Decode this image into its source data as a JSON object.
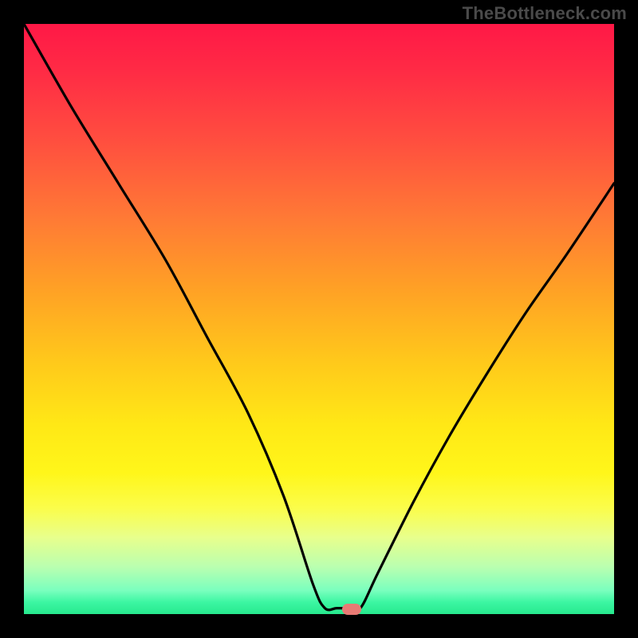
{
  "watermark": "TheBottleneck.com",
  "chart_data": {
    "type": "line",
    "title": "",
    "xlabel": "",
    "ylabel": "",
    "xlim": [
      0,
      100
    ],
    "ylim": [
      0,
      100
    ],
    "grid": false,
    "series": [
      {
        "name": "curve",
        "x": [
          0,
          8,
          16,
          24,
          31,
          38,
          44,
          49,
          51,
          53,
          55,
          57,
          60,
          66,
          72,
          78,
          85,
          92,
          100
        ],
        "y": [
          100,
          86,
          73,
          60,
          47,
          34,
          20,
          5,
          1,
          1,
          1,
          1,
          7,
          19,
          30,
          40,
          51,
          61,
          73
        ]
      }
    ],
    "marker": {
      "x": 55.5,
      "y": 0.8
    },
    "background_gradient": {
      "stops": [
        {
          "pos": 0,
          "color": "#ff1846"
        },
        {
          "pos": 20,
          "color": "#ff4f3f"
        },
        {
          "pos": 45,
          "color": "#ffa125"
        },
        {
          "pos": 68,
          "color": "#ffe816"
        },
        {
          "pos": 87,
          "color": "#e8ff8c"
        },
        {
          "pos": 100,
          "color": "#27e98e"
        }
      ]
    }
  }
}
